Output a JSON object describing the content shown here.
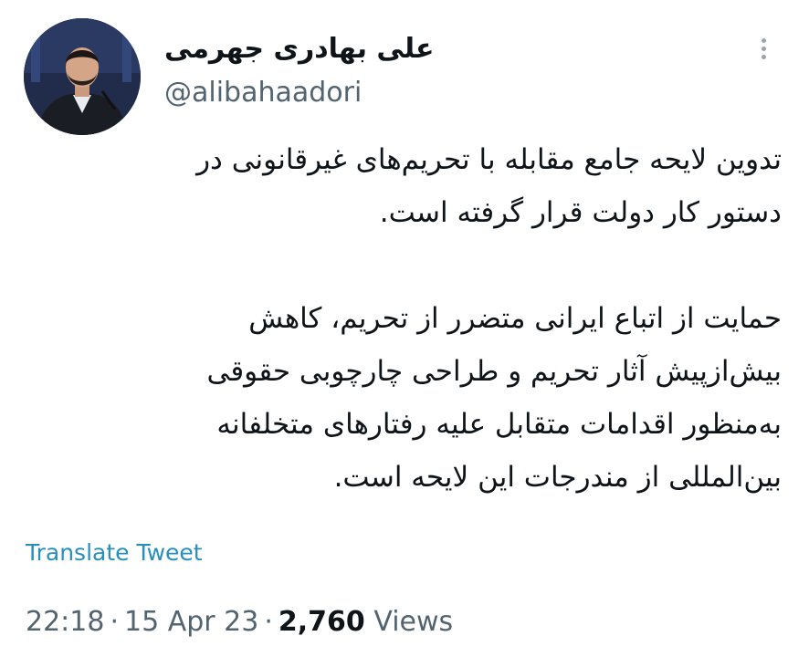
{
  "author": {
    "display_name": "علی بهادری جهرمی",
    "handle": "@alibahaadori"
  },
  "tweet": {
    "paragraphs": [
      [
        "تدوین لایحه جامع مقابله با تحریم‌های غیرقانونی در",
        "دستور کار دولت قرار گرفته است."
      ],
      [
        "حمایت از اتباع ایرانی متضرر از تحریم، کاهش",
        "بیش‌ازپیش آثار تحریم و طراحی چارچوبی حقوقی",
        "به‌منظور اقدامات متقابل علیه رفتارهای متخلفانه",
        "بین‌المللی از مندرجات این لایحه است."
      ]
    ],
    "translate_label": "Translate Tweet"
  },
  "meta": {
    "time": "22:18",
    "separator": "·",
    "date": "15 Apr 23",
    "views_count": "2,760",
    "views_label": "Views"
  },
  "icons": {
    "more": "more-vertical-icon",
    "avatar": "profile-photo"
  },
  "colors": {
    "link": "#2a8fb8",
    "secondary_text": "#536471",
    "primary_text": "#0f1419"
  }
}
